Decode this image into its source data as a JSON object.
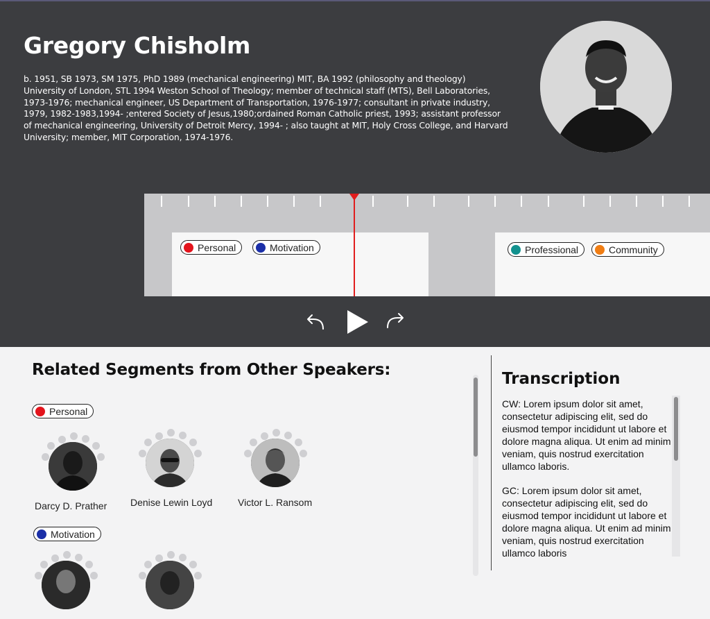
{
  "profile": {
    "name": "Gregory Chisholm",
    "bio": "b. 1951, SB 1973, SM 1975, PhD 1989 (mechanical engineering) MIT, BA 1992 (philosophy and theology) University of London, STL 1994 Weston School of Theology;  member of technical staff (MTS), Bell Laboratories, 1973-1976; mechanical engineer, US Department of Transportation, 1976-1977; consultant in private industry, 1979,  1982-1983,1994- ;entered Society of Jesus,1980;ordained Roman Catholic priest, 1993; assistant professor of mechanical engineering, University of Detroit Mercy, 1994- ; also taught at MIT, Holy Cross College, and Harvard University;  member, MIT Corporation, 1974-1976."
  },
  "timeline": {
    "segments": [
      {
        "tags": [
          {
            "label": "Personal",
            "color": "#e3141c"
          },
          {
            "label": "Motivation",
            "color": "#1b2fa8"
          }
        ]
      },
      {
        "tags": [
          {
            "label": "Professional",
            "color": "#12918e"
          },
          {
            "label": "Community",
            "color": "#f07d13"
          }
        ]
      }
    ]
  },
  "controls": {
    "back_icon": "rewind-icon",
    "play_icon": "play-icon",
    "forward_icon": "forward-icon"
  },
  "related": {
    "title": "Related Segments from Other Speakers:",
    "groups": [
      {
        "tag": {
          "label": "Personal",
          "color": "#e3141c"
        },
        "speakers": [
          {
            "name": "Darcy D. Prather"
          },
          {
            "name": "Denise Lewin Loyd"
          },
          {
            "name": "Victor L. Ransom"
          }
        ]
      },
      {
        "tag": {
          "label": "Motivation",
          "color": "#1b2fa8"
        },
        "speakers": [
          {
            "name": ""
          },
          {
            "name": ""
          }
        ]
      }
    ]
  },
  "transcription": {
    "title": "Transcription",
    "paragraphs": [
      "CW: Lorem ipsum dolor sit amet, consectetur adipiscing elit, sed do eiusmod tempor incididunt ut labore et dolore magna aliqua. Ut enim ad minim veniam, quis nostrud exercitation ullamco laboris.",
      "GC: Lorem ipsum dolor sit amet, consectetur adipiscing elit, sed do eiusmod tempor incididunt ut labore et dolore magna aliqua. Ut enim ad minim veniam, quis nostrud exercitation ullamco laboris"
    ]
  }
}
